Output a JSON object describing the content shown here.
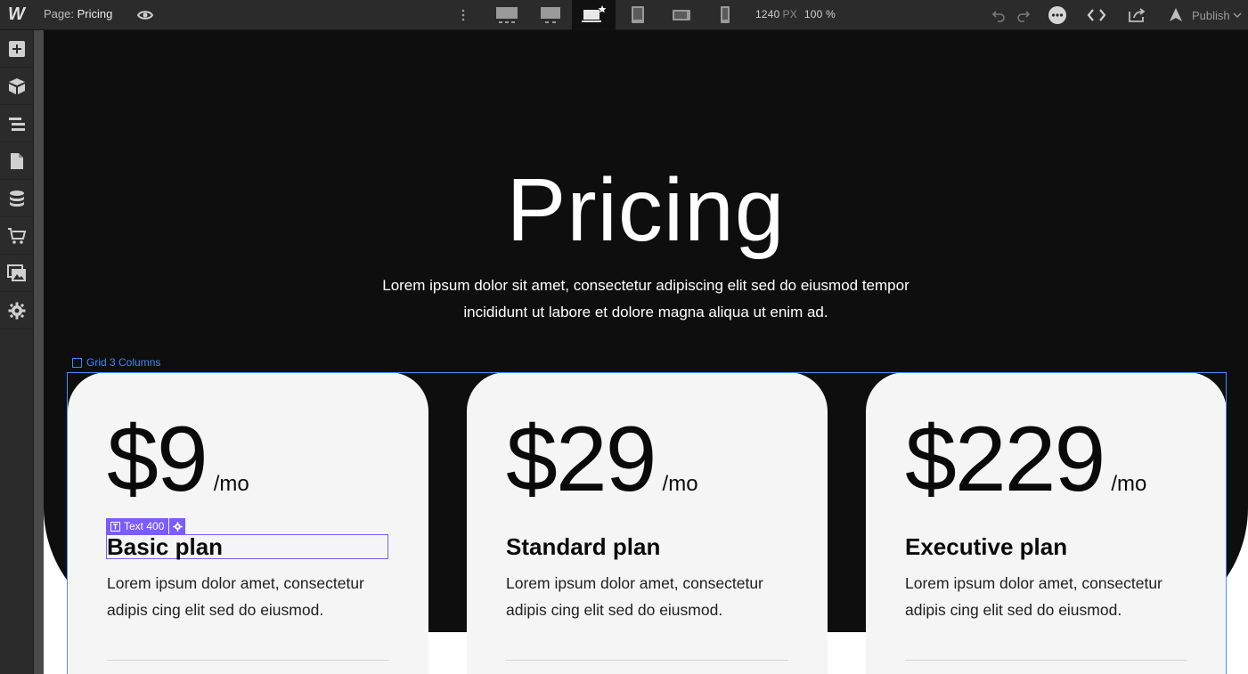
{
  "topbar": {
    "page_prefix": "Page:",
    "page_name": "Pricing",
    "width_value": "1240",
    "width_unit": "PX",
    "zoom": "100 %",
    "publish_label": "Publish"
  },
  "leftbar": {
    "items": [
      "add-icon",
      "components-icon",
      "navigator-icon",
      "pages-icon",
      "cms-icon",
      "ecommerce-icon",
      "assets-icon",
      "settings-icon"
    ]
  },
  "hero": {
    "title": "Pricing",
    "subtitle": "Lorem ipsum dolor sit amet, consectetur adipiscing elit sed do eiusmod tempor incididunt ut labore et dolore magna aliqua ut enim ad."
  },
  "grid_label": "Grid 3 Columns",
  "selection": {
    "tag": "Text 400"
  },
  "cards": [
    {
      "price": "$9",
      "period": "/mo",
      "plan": "Basic plan",
      "desc": "Lorem ipsum dolor amet, consectetur adipis cing elit sed do eiusmod."
    },
    {
      "price": "$29",
      "period": "/mo",
      "plan": "Standard plan",
      "desc": "Lorem ipsum dolor amet, consectetur adipis cing elit sed do eiusmod."
    },
    {
      "price": "$229",
      "period": "/mo",
      "plan": "Executive plan",
      "desc": "Lorem ipsum dolor amet, consectetur adipis cing elit sed do eiusmod."
    }
  ],
  "colors": {
    "selection": "#7a5cff",
    "grid_outline": "#3e86ff",
    "hero_bg": "#0e0e0e",
    "card_bg": "#f5f5f5"
  }
}
